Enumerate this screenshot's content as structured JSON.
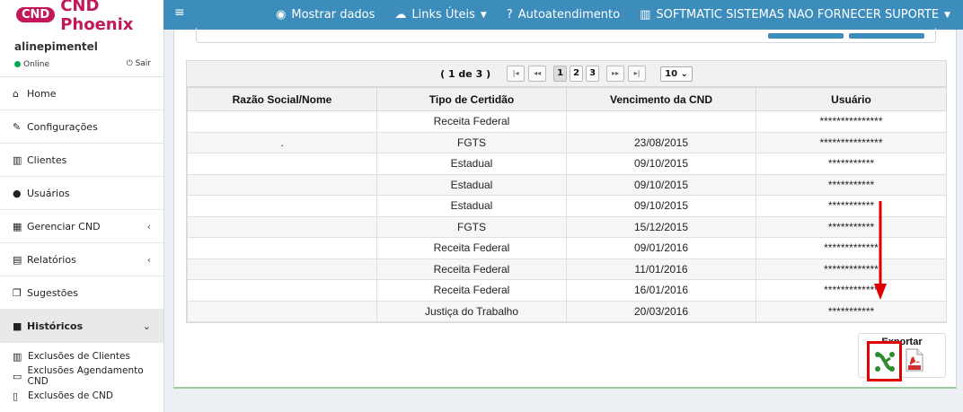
{
  "app": {
    "logo_badge": "CND",
    "logo_text": "CND Phoenix"
  },
  "topbar": {
    "menu_icon": "hamburger-icon",
    "items": [
      {
        "icon": "eye-icon",
        "label": "Mostrar dados",
        "caret": false
      },
      {
        "icon": "cloud-icon",
        "label": "Links Úteis",
        "caret": true
      },
      {
        "icon": "question-circle-icon",
        "label": "Autoatendimento",
        "caret": false
      },
      {
        "icon": "building-icon",
        "label": "SOFTMATIC SISTEMAS NAO FORNECER SUPORTE",
        "caret": true
      }
    ],
    "color": "#3c8dbc"
  },
  "user": {
    "name": "alinepimentel",
    "status": "Online",
    "logout": "Sair",
    "status_color": "#00a65a"
  },
  "sidebar": {
    "items": [
      {
        "icon": "home-icon",
        "label": "Home",
        "chevron": ""
      },
      {
        "icon": "wrench-icon",
        "label": "Configurações",
        "chevron": ""
      },
      {
        "icon": "building-icon",
        "label": "Clientes",
        "chevron": ""
      },
      {
        "icon": "user-icon",
        "label": "Usuários",
        "chevron": ""
      },
      {
        "icon": "calendar-icon",
        "label": "Gerenciar CND",
        "chevron": "‹"
      },
      {
        "icon": "file-icon",
        "label": "Relatórios",
        "chevron": "‹"
      },
      {
        "icon": "comments-icon",
        "label": "Sugestões",
        "chevron": ""
      },
      {
        "icon": "archive-icon",
        "label": "Históricos",
        "chevron": "⌄"
      }
    ],
    "subitems": [
      {
        "icon": "building-icon",
        "label": "Exclusões de Clientes"
      },
      {
        "icon": "calendar-icon",
        "label": "Exclusões Agendamento CND"
      },
      {
        "icon": "trash-icon",
        "label": "Exclusões de CND"
      }
    ]
  },
  "pager": {
    "info": "( 1 de 3 )",
    "first": "|◂",
    "prev": "◂◂",
    "pages": [
      "1",
      "2",
      "3"
    ],
    "current": "1",
    "next": "▸▸",
    "last": "▸|",
    "page_size": "10"
  },
  "table": {
    "columns": [
      "Razão Social/Nome",
      "Tipo de Certidão",
      "Vencimento da CND",
      "Usuário"
    ],
    "rows": [
      [
        "",
        "Receita Federal",
        "",
        "***************"
      ],
      [
        ".",
        "FGTS",
        "23/08/2015",
        "***************"
      ],
      [
        "",
        "Estadual",
        "09/10/2015",
        "***********"
      ],
      [
        "",
        "Estadual",
        "09/10/2015",
        "***********"
      ],
      [
        "",
        "Estadual",
        "09/10/2015",
        "***********"
      ],
      [
        "",
        "FGTS",
        "15/12/2015",
        "***********"
      ],
      [
        "",
        "Receita Federal",
        "09/01/2016",
        "*************"
      ],
      [
        "",
        "Receita Federal",
        "11/01/2016",
        "*************"
      ],
      [
        "",
        "Receita Federal",
        "16/01/2016",
        "*************"
      ],
      [
        "",
        "Justiça do Trabalho",
        "20/03/2016",
        "***********"
      ]
    ]
  },
  "export": {
    "label": "Exportar",
    "excel_icon": "excel-export-icon",
    "pdf_icon": "pdf-export-icon",
    "highlight_color": "#e00000"
  }
}
